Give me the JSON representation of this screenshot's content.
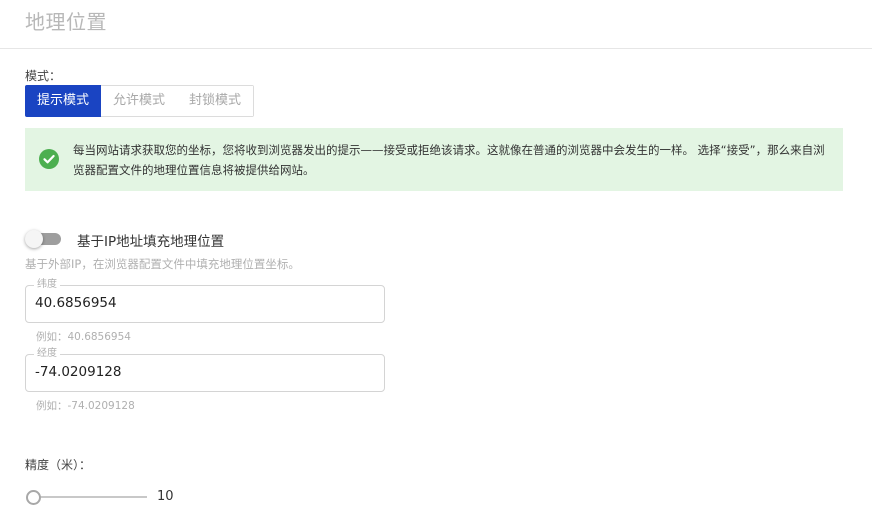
{
  "header": {
    "title": "地理位置"
  },
  "mode": {
    "label": "模式：",
    "options": [
      "提示模式",
      "允许模式",
      "封锁模式"
    ],
    "selected": "提示模式"
  },
  "info": {
    "text": "每当网站请求获取您的坐标，您将收到浏览器发出的提示——接受或拒绝该请求。这就像在普通的浏览器中会发生的一样。 选择“接受”，那么来自浏览器配置文件的地理位置信息将被提供给网站。",
    "icon": "check-circle-icon",
    "color": "#4caf50",
    "background": "#e3f5e3"
  },
  "ip_toggle": {
    "label": "基于IP地址填充地理位置",
    "description": "基于外部IP，在浏览器配置文件中填充地理位置坐标。",
    "enabled": false
  },
  "latitude": {
    "legend": "纬度",
    "value": "40.6856954",
    "hint": "例如：40.6856954"
  },
  "longitude": {
    "legend": "经度",
    "value": "-74.0209128",
    "hint": "例如：-74.0209128"
  },
  "accuracy": {
    "label": "精度（米）：",
    "value": "10",
    "fraction": 0
  },
  "colors": {
    "accent": "#1a44c2",
    "success": "#4caf50"
  }
}
